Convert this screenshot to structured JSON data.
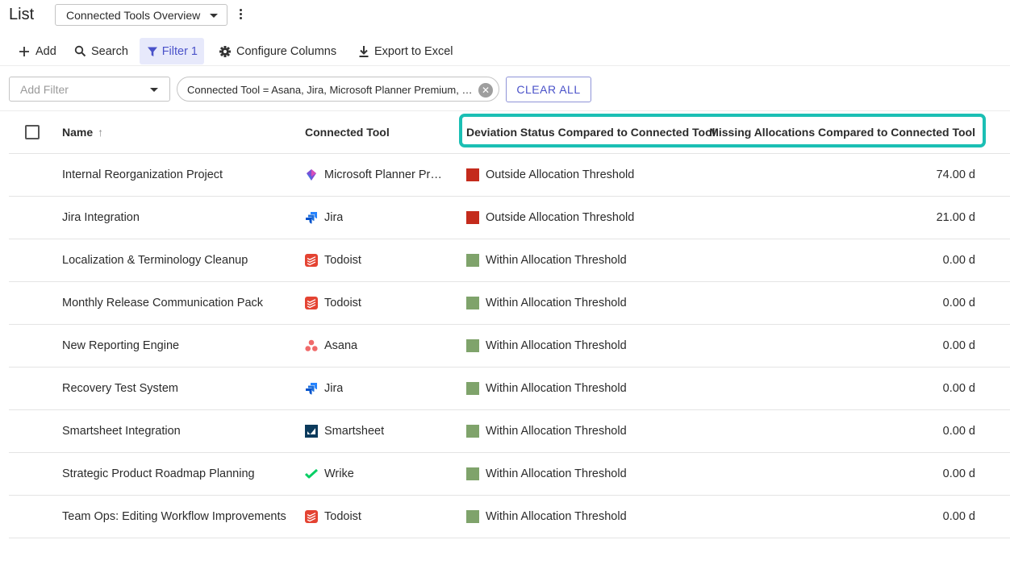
{
  "colors": {
    "accent": "#4a52c9",
    "highlight": "#1bbfb4",
    "outside_threshold": "#c42b1c",
    "within_threshold": "#7fa36b"
  },
  "header": {
    "title": "List",
    "view_selector": "Connected Tools Overview"
  },
  "toolbar": {
    "add": "Add",
    "search": "Search",
    "filter": "Filter",
    "filter_count": "1",
    "configure_columns": "Configure Columns",
    "export": "Export to Excel"
  },
  "filters": {
    "add_filter_placeholder": "Add Filter",
    "chip": "Connected Tool = Asana, Jira, Microsoft Planner Premium, Smartsheet, Todoist, Wrike",
    "clear_all": "CLEAR ALL"
  },
  "table": {
    "columns": {
      "name": "Name",
      "connected_tool": "Connected Tool",
      "deviation_status": "Deviation Status Compared to Connected Tool",
      "missing_allocations": "Missing Allocations Compared to Connected Tool"
    },
    "rows": [
      {
        "name": "Internal Reorganization Project",
        "tool": "Microsoft Planner Premium",
        "tool_icon": "microsoft-planner-icon",
        "status": "Outside Allocation Threshold",
        "status_level": "outside",
        "missing": "74.00 d"
      },
      {
        "name": "Jira Integration",
        "tool": "Jira",
        "tool_icon": "jira-icon",
        "status": "Outside Allocation Threshold",
        "status_level": "outside",
        "missing": "21.00 d"
      },
      {
        "name": "Localization & Terminology Cleanup",
        "tool": "Todoist",
        "tool_icon": "todoist-icon",
        "status": "Within Allocation Threshold",
        "status_level": "within",
        "missing": "0.00 d"
      },
      {
        "name": "Monthly Release Communication Pack",
        "tool": "Todoist",
        "tool_icon": "todoist-icon",
        "status": "Within Allocation Threshold",
        "status_level": "within",
        "missing": "0.00 d"
      },
      {
        "name": "New Reporting Engine",
        "tool": "Asana",
        "tool_icon": "asana-icon",
        "status": "Within Allocation Threshold",
        "status_level": "within",
        "missing": "0.00 d"
      },
      {
        "name": "Recovery Test System",
        "tool": "Jira",
        "tool_icon": "jira-icon",
        "status": "Within Allocation Threshold",
        "status_level": "within",
        "missing": "0.00 d"
      },
      {
        "name": "Smartsheet Integration",
        "tool": "Smartsheet",
        "tool_icon": "smartsheet-icon",
        "status": "Within Allocation Threshold",
        "status_level": "within",
        "missing": "0.00 d"
      },
      {
        "name": "Strategic Product Roadmap Planning",
        "tool": "Wrike",
        "tool_icon": "wrike-icon",
        "status": "Within Allocation Threshold",
        "status_level": "within",
        "missing": "0.00 d"
      },
      {
        "name": "Team Ops: Editing Workflow Improvements",
        "tool": "Todoist",
        "tool_icon": "todoist-icon",
        "status": "Within Allocation Threshold",
        "status_level": "within",
        "missing": "0.00 d"
      }
    ]
  }
}
